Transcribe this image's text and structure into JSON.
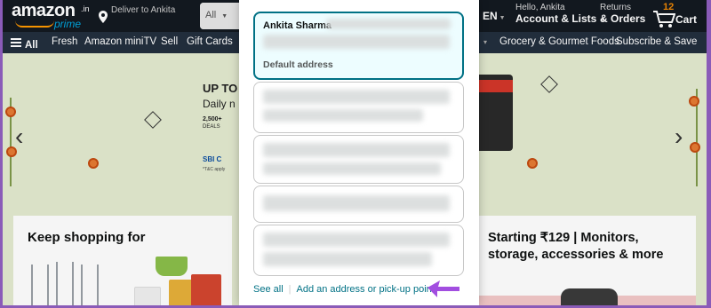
{
  "header": {
    "logo_text": "amazon",
    "logo_tld": ".in",
    "logo_prime": "prime",
    "deliver_to": "Deliver to Ankita",
    "search_category": "All",
    "language": "EN",
    "account_greeting": "Hello, Ankita",
    "account_label": "Account & Lists",
    "returns_label": "Returns",
    "orders_label": "& Orders",
    "cart_count": "12",
    "cart_label": "Cart"
  },
  "nav": {
    "all_label": "All",
    "items": [
      "Fresh",
      "Amazon miniTV",
      "Sell",
      "Gift Cards",
      "Grocery & Gourmet Foods",
      "Subscribe & Save"
    ]
  },
  "hero": {
    "title": "UP TO",
    "subtitle": "Daily n",
    "deals_count": "2,500+",
    "deals_label": "DEALS",
    "bank": "SBI C",
    "tnc": "*T&C apply"
  },
  "cards": {
    "left_title": "Keep shopping for",
    "right_title": "Starting ₹129 | Monitors, storage, accessories & more"
  },
  "address_modal": {
    "addresses": [
      {
        "name": "Ankita Sharma",
        "badge": "Default address",
        "selected": true
      }
    ],
    "see_all": "See all",
    "add_address": "Add an address or pick-up point"
  },
  "colors": {
    "header_bg": "#131921",
    "nav_bg": "#232f3e",
    "selected_border": "#007185",
    "selected_bg": "#edfdff",
    "link": "#007185",
    "frame": "#8a5bb8",
    "pointer": "#a24ee0"
  }
}
